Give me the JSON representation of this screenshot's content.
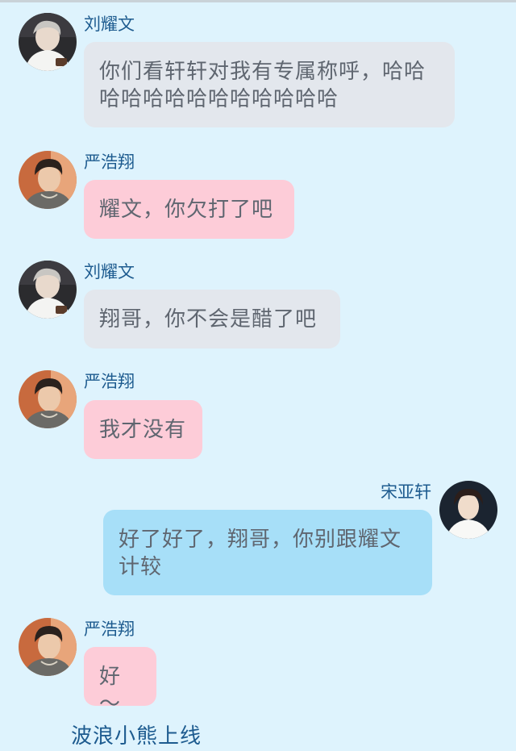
{
  "colors": {
    "background": "#def3fd",
    "name_text": "#1d5b8f",
    "message_text": "#5f6670",
    "bubble_gray": "#e3e7ed",
    "bubble_pink": "#fdccd8",
    "bubble_blue": "#a7dff8"
  },
  "messages": [
    {
      "sender": "刘耀文",
      "text": "你们看轩轩对我有专属称呼，哈哈哈哈哈哈哈哈哈哈哈哈哈"
    },
    {
      "sender": "严浩翔",
      "text": "耀文，你欠打了吧"
    },
    {
      "sender": "刘耀文",
      "text": "翔哥，你不会是醋了吧"
    },
    {
      "sender": "严浩翔",
      "text": "我才没有"
    },
    {
      "sender": "宋亚轩",
      "text": "好了好了，翔哥，你别跟耀文计较"
    },
    {
      "sender": "严浩翔",
      "text": "好～"
    }
  ],
  "footer": {
    "caption": "波浪小熊上线"
  }
}
